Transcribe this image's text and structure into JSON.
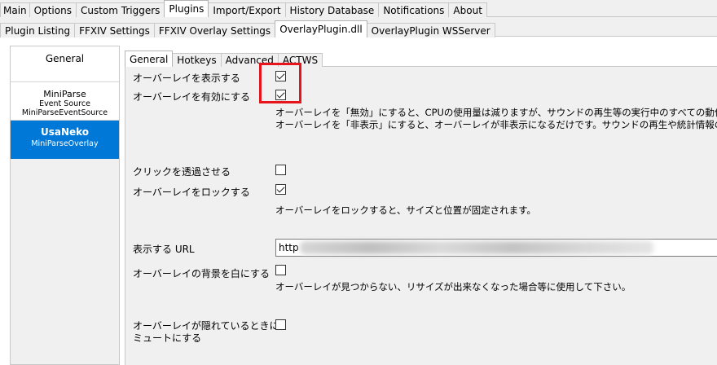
{
  "top_tabs": [
    "Main",
    "Options",
    "Custom Triggers",
    "Plugins",
    "Import/Export",
    "History Database",
    "Notifications",
    "About"
  ],
  "top_tabs_active": 3,
  "sub_tabs": [
    "Plugin Listing",
    "FFXIV Settings",
    "FFXIV Overlay Settings",
    "OverlayPlugin.dll",
    "OverlayPlugin WSServer"
  ],
  "sub_tabs_active": 3,
  "overlay_list": {
    "general": "General",
    "miniparse": {
      "title": "MiniParse",
      "type": "Event Source",
      "source": "MiniParseEventSource"
    },
    "usaneko": {
      "title": "UsaNeko",
      "type": "MiniParseOverlay"
    }
  },
  "inner_tabs": [
    "General",
    "Hotkeys",
    "Advanced",
    "ACTWS"
  ],
  "settings": {
    "show_overlay": "オーバーレイを表示する",
    "enable_overlay": "オーバーレイを有効にする",
    "enable_desc_1": "オーバーレイを「無効」にすると、CPUの使用量は減りますが、サウンドの再生等の実行中のすべての動作",
    "enable_desc_2": "オーバーレイを「非表示」にすると、オーバーレイが非表示になるだけです。サウンドの再生や統計情報の収",
    "click_through": "クリックを透過させる",
    "lock_overlay": "オーバーレイをロックする",
    "lock_desc": "オーバーレイをロックすると、サイズと位置が固定されます。",
    "url_label": "表示する URL",
    "url_value": "http",
    "white_bg": "オーバーレイの背景を白にする",
    "white_bg_desc": "オーバーレイが見つからない、リサイズが出来なくなった場合等に使用して下さい。",
    "mute_hidden_1": "オーバーレイが隠れているときに",
    "mute_hidden_2": "ミュートにする"
  },
  "checkbox_states": {
    "show_overlay": true,
    "enable_overlay": true,
    "click_through": false,
    "lock_overlay": true,
    "white_bg": false,
    "mute_hidden": false
  },
  "colors": {
    "highlight_box": "#e8141c",
    "selected_item": "#0078d7"
  }
}
